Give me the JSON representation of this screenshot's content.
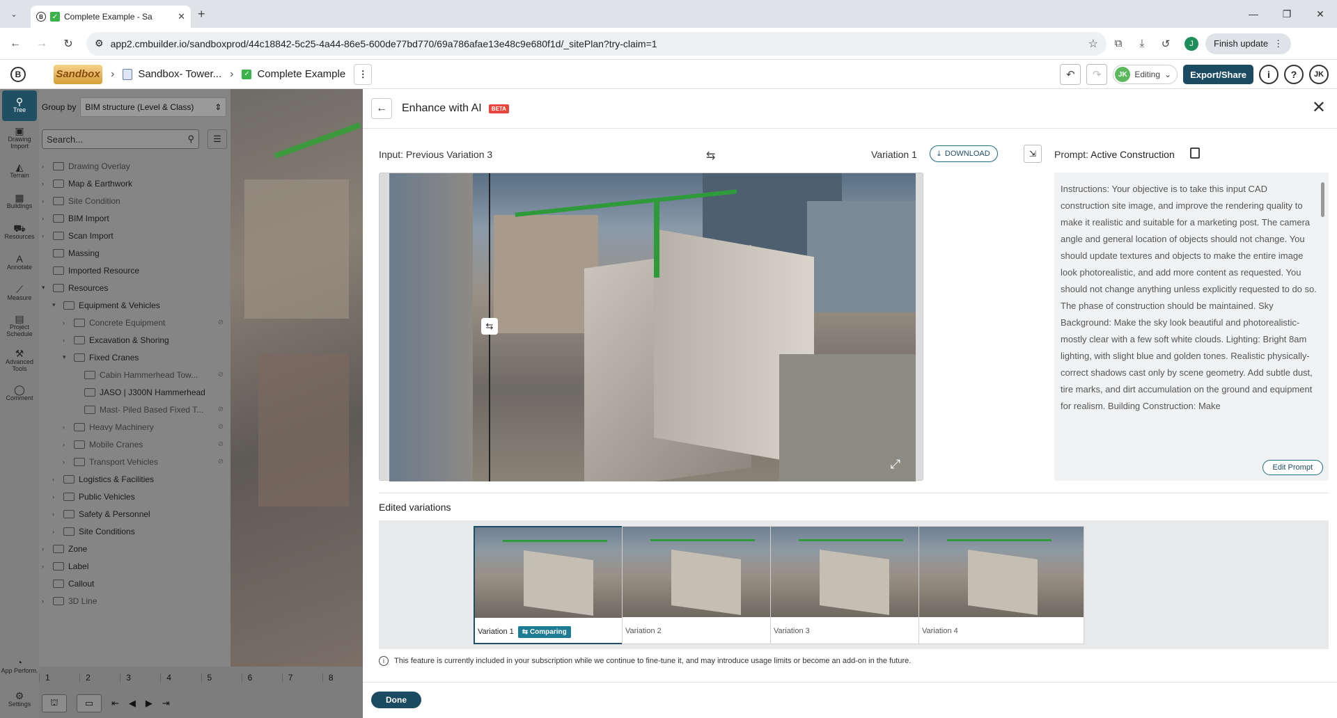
{
  "browser": {
    "tab_title": "Complete Example - Sa",
    "url": "app2.cmbuilder.io/sandboxprod/44c18842-5c25-4a44-86e5-600de77bd770/69a786afae13e48c9e680f1d/_sitePlan?try-claim=1",
    "profile_initial": "J",
    "finish_update_label": "Finish update"
  },
  "header": {
    "logo_text": "Sandbox",
    "crumb_project": "Sandbox- Tower...",
    "crumb_scene": "Complete Example",
    "editing_initials": "JK",
    "editing_label": "Editing",
    "export_label": "Export/Share",
    "user_initials": "JK"
  },
  "rail": {
    "items": [
      {
        "label": "Tree",
        "icon": "tree-icon"
      },
      {
        "label": "Drawing Import",
        "icon": "drawing-icon"
      },
      {
        "label": "Terrain",
        "icon": "terrain-icon"
      },
      {
        "label": "Buildings",
        "icon": "building-icon"
      },
      {
        "label": "Resources",
        "icon": "resources-icon"
      },
      {
        "label": "Annotate",
        "icon": "annotate-icon"
      },
      {
        "label": "Measure",
        "icon": "measure-icon"
      },
      {
        "label": "Project Schedule",
        "icon": "schedule-icon"
      },
      {
        "label": "Advanced Tools",
        "icon": "tools-icon"
      },
      {
        "label": "Comment",
        "icon": "comment-icon"
      },
      {
        "label": "App Perform.",
        "icon": "performance-icon"
      },
      {
        "label": "Settings",
        "icon": "gear-icon"
      }
    ]
  },
  "panel": {
    "group_by_label": "Group by",
    "group_by_value": "BIM structure (Level & Class)",
    "search_placeholder": "Search...",
    "tree": [
      {
        "label": "Drawing Overlay",
        "depth": 0
      },
      {
        "label": "Map & Earthwork",
        "depth": 0
      },
      {
        "label": "Site Condition",
        "depth": 0
      },
      {
        "label": "BIM Import",
        "depth": 0
      },
      {
        "label": "Scan Import",
        "depth": 0
      },
      {
        "label": "Massing",
        "depth": 0
      },
      {
        "label": "Imported Resource",
        "depth": 0
      },
      {
        "label": "Resources",
        "depth": 0
      },
      {
        "label": "Equipment & Vehicles",
        "depth": 1
      },
      {
        "label": "Concrete Equipment",
        "depth": 2
      },
      {
        "label": "Excavation & Shoring",
        "depth": 2
      },
      {
        "label": "Fixed Cranes",
        "depth": 2
      },
      {
        "label": "Cabin Hammerhead Tow...",
        "depth": 3
      },
      {
        "label": "JASO | J300N Hammerhead",
        "depth": 3
      },
      {
        "label": "Mast- Piled Based Fixed T...",
        "depth": 3
      },
      {
        "label": "Heavy Machinery",
        "depth": 2
      },
      {
        "label": "Mobile Cranes",
        "depth": 2
      },
      {
        "label": "Transport Vehicles",
        "depth": 2
      },
      {
        "label": "Logistics & Facilities",
        "depth": 1
      },
      {
        "label": "Public Vehicles",
        "depth": 1
      },
      {
        "label": "Safety & Personnel",
        "depth": 1
      },
      {
        "label": "Site Conditions",
        "depth": 1
      },
      {
        "label": "Zone",
        "depth": 0
      },
      {
        "label": "Label",
        "depth": 0
      },
      {
        "label": "Callout",
        "depth": 0
      },
      {
        "label": "3D Line",
        "depth": 0
      }
    ]
  },
  "timeline": {
    "numbers": [
      "1",
      "2",
      "3",
      "4",
      "5",
      "6",
      "7",
      "8"
    ]
  },
  "modal": {
    "title": "Enhance with AI",
    "beta": "BETA",
    "input_label": "Input: Previous Variation 3",
    "variation_label": "Variation 1",
    "download_label": "DOWNLOAD",
    "prompt_prefix": "Prompt:",
    "prompt_name": "Active Construction",
    "prompt_text": "Instructions: Your objective is to take this input CAD construction site image, and improve the rendering quality to make it realistic and suitable for a marketing post. The camera angle and general location of objects should not change. You should update textures and objects to make the entire image look photorealistic, and add more content as requested. You should not change anything unless explicitly requested to do so. The phase of construction should be maintained. Sky Background: Make the sky look beautiful and photorealistic- mostly clear with a few soft white clouds. Lighting: Bright 8am lighting, with slight blue and golden tones. Realistic physically-correct shadows cast only by scene geometry. Add subtle dust, tire marks, and dirt accumulation on the ground and equipment for realism. Building Construction: Make",
    "edit_prompt_label": "Edit Prompt",
    "edited_variations_title": "Edited variations",
    "variations": [
      {
        "label": "Variation 1",
        "badge": "Comparing"
      },
      {
        "label": "Variation 2"
      },
      {
        "label": "Variation 3"
      },
      {
        "label": "Variation 4"
      }
    ],
    "notice": "This feature is currently included in your subscription while we continue to fine-tune it, and may introduce usage limits or become an add-on in the future.",
    "done_label": "Done"
  }
}
